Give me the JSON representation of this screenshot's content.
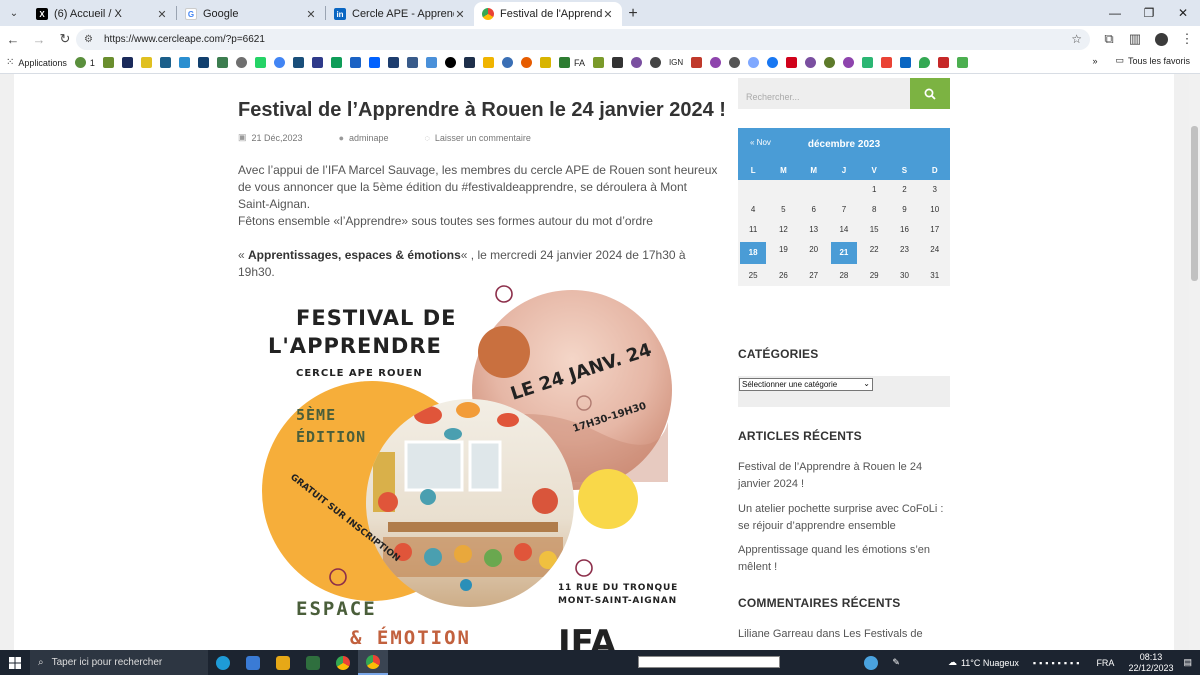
{
  "tabs": [
    {
      "title": "(6) Accueil / X",
      "icon": "x-logo-icon",
      "color": "#000000"
    },
    {
      "title": "Google",
      "icon": "google-icon",
      "color": "#ffffff"
    },
    {
      "title": "Cercle APE - Apprendre Ensemble",
      "icon": "linkedin-icon",
      "color": "#0a66c2"
    },
    {
      "title": "Festival de l'Apprendre à Rouen",
      "icon": "chrome-page-icon",
      "color": "#4285f4"
    }
  ],
  "address_bar": {
    "url": "https://www.cercleape.com/?p=6621"
  },
  "bookmarks": {
    "apps_label": "Applications",
    "item_1_label": "1",
    "fa_label": "FA",
    "ign_label": "IGN",
    "all_favorites_label": "Tous les favoris"
  },
  "post": {
    "title": "Festival de l’Apprendre à Rouen le 24 janvier 2024 !",
    "date": "21 Déc,2023",
    "author": "adminape",
    "comment_link": "Laisser un commentaire",
    "para1": "Avec l’appui de l’IFA Marcel Sauvage, les membres du cercle APE de Rouen sont heureux de vous annoncer que la 5ème édition du #festivaldeapprendre, se déroulera à Mont Saint-Aignan.",
    "para2": "Fêtons ensemble «l’Apprendre» sous toutes ses formes autour du mot d’ordre",
    "para3_prefix": "« ",
    "para3_bold": "Apprentissages, espaces & émotions",
    "para3_suffix": "« , le mercredi 24 janvier 2024 de 17h30 à 19h30."
  },
  "poster": {
    "title_line1": "FESTIVAL DE",
    "title_line2": "L'APPRENDRE",
    "org": "CERCLE APE ROUEN",
    "edition_line1": "5ÈME",
    "edition_line2": "ÉDITION",
    "free": "GRATUIT SUR INSCRIPTION",
    "date": "LE 24 JANV. 24",
    "hours": "17H30-19H30",
    "address_line1": "11 RUE DU TRONQUET",
    "address_line2": "MONT-SAINT-AIGNAN",
    "theme_line1": "ESPACE",
    "theme_line2": "& ÉMOTION",
    "logo": "IFA"
  },
  "sidebar": {
    "search_placeholder": "Rechercher...",
    "calendar": {
      "prev": "« Nov",
      "month": "décembre 2023",
      "weekdays": [
        "L",
        "M",
        "M",
        "J",
        "V",
        "S",
        "D"
      ],
      "weeks": [
        [
          "",
          "",
          "",
          "",
          "1",
          "2",
          "3"
        ],
        [
          "4",
          "5",
          "6",
          "7",
          "8",
          "9",
          "10"
        ],
        [
          "11",
          "12",
          "13",
          "14",
          "15",
          "16",
          "17"
        ],
        [
          "18",
          "19",
          "20",
          "21",
          "22",
          "23",
          "24"
        ],
        [
          "25",
          "26",
          "27",
          "28",
          "29",
          "30",
          "31"
        ]
      ],
      "highlighted": [
        "18",
        "21"
      ]
    },
    "categories_title": "CATÉGORIES",
    "categories_select": "Sélectionner une catégorie",
    "recent_title": "ARTICLES RÉCENTS",
    "recent_articles": [
      "Festival de l’Apprendre à Rouen le 24 janvier 2024 !",
      "Un atelier pochette surprise avec CoFoLi : se réjouir d’apprendre ensemble",
      "Apprentissage quand les émotions s’en mêlent !"
    ],
    "comments_title": "COMMENTAIRES RÉCENTS",
    "recent_comment": "Liliane Garreau dans Les Festivals de"
  },
  "taskbar": {
    "search_placeholder": "Taper ici pour rechercher",
    "weather": "11°C  Nuageux",
    "lang": "FRA",
    "time": "08:13",
    "date": "22/12/2023"
  },
  "colors": {
    "accent_blue": "#4a9cd6",
    "search_green": "#7cb342",
    "poster_orange": "#f6ae3a",
    "poster_pink": "#e8c3b4",
    "poster_yellow": "#f9d849",
    "poster_green": "#4a5e3a",
    "poster_rust": "#c2613e"
  }
}
